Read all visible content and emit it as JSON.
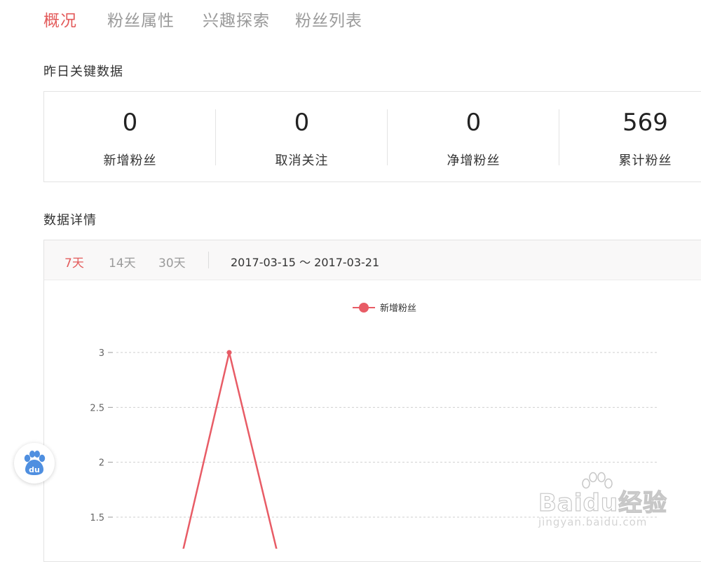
{
  "tabs": [
    {
      "label": "概况",
      "active": true
    },
    {
      "label": "粉丝属性",
      "active": false
    },
    {
      "label": "兴趣探索",
      "active": false
    },
    {
      "label": "粉丝列表",
      "active": false
    }
  ],
  "key_data": {
    "title": "昨日关键数据",
    "stats": [
      {
        "value": "0",
        "label": "新增粉丝"
      },
      {
        "value": "0",
        "label": "取消关注"
      },
      {
        "value": "0",
        "label": "净增粉丝"
      },
      {
        "value": "569",
        "label": "累计粉丝"
      }
    ]
  },
  "detail": {
    "title": "数据详情",
    "ranges": [
      {
        "label": "7天",
        "active": true
      },
      {
        "label": "14天",
        "active": false
      },
      {
        "label": "30天",
        "active": false
      }
    ],
    "date_range": "2017-03-15 ～ 2017-03-21"
  },
  "chart_data": {
    "type": "line",
    "legend": [
      "新增粉丝"
    ],
    "legend_position": "top-center",
    "y_ticks": [
      "3",
      "2.5",
      "2",
      "1.5"
    ],
    "ylim": [
      1.5,
      3
    ],
    "grid": true,
    "series": [
      {
        "name": "新增粉丝",
        "color": "#e85c66",
        "visible_points": [
          {
            "y": 3
          }
        ]
      }
    ]
  },
  "floating_button": {
    "icon": "baidu-paw-icon",
    "text": "du"
  },
  "watermark": {
    "main": "Baidu经验",
    "sub": "jingyan.baidu.com"
  },
  "colors": {
    "accent": "#e35b5b",
    "line": "#e85c66",
    "muted": "#9a9a9a"
  }
}
